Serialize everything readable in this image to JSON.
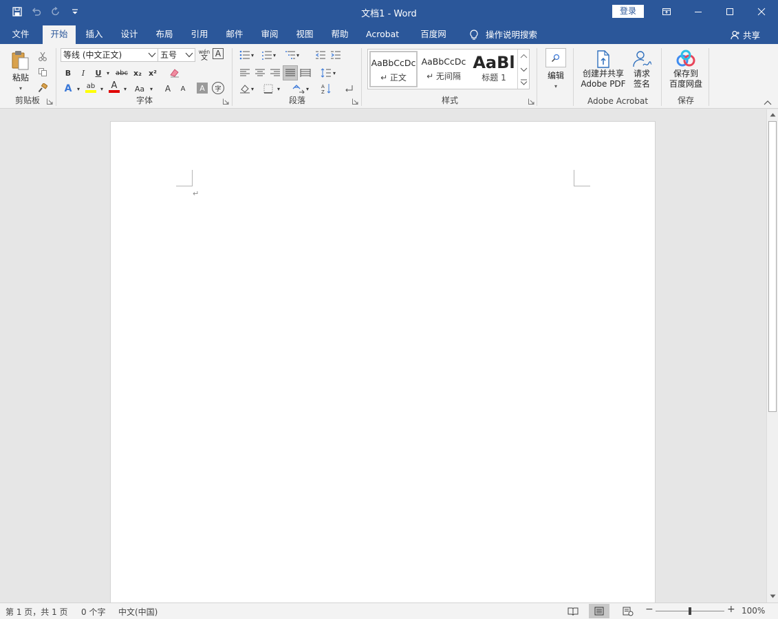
{
  "window": {
    "title": "文档1  -  Word",
    "login_label": "登录"
  },
  "tabs": [
    "文件",
    "开始",
    "插入",
    "设计",
    "布局",
    "引用",
    "邮件",
    "审阅",
    "视图",
    "帮助",
    "Acrobat",
    "百度网盘"
  ],
  "active_tab": "开始",
  "tell_me": "操作说明搜索",
  "share_label": "共享",
  "ribbon": {
    "clipboard": {
      "label": "剪贴板",
      "paste": "粘贴"
    },
    "font": {
      "label": "字体",
      "font_name": "等线 (中文正文)",
      "font_size": "五号",
      "phonetic_top": "wén",
      "phonetic_bottom": "文",
      "bold": "B",
      "italic": "I",
      "underline": "U",
      "strike": "abc",
      "subscript": "x₂",
      "superscript": "x²",
      "text_effects": "A",
      "highlight": "ab",
      "font_color": "A",
      "change_case": "Aa",
      "grow": "A",
      "shrink": "A",
      "char_shading": "A",
      "enclose": "字"
    },
    "paragraph": {
      "label": "段落"
    },
    "styles": {
      "label": "样式",
      "items": [
        {
          "sample": "AaBbCcDc",
          "name": "↵ 正文"
        },
        {
          "sample": "AaBbCcDc",
          "name": "↵ 无间隔"
        },
        {
          "sample": "AaBl",
          "name": "标题 1"
        }
      ]
    },
    "editing": {
      "label": "编辑"
    },
    "acrobat": {
      "label": "Adobe Acrobat",
      "create_line1": "创建并共享",
      "create_line2": "Adobe PDF",
      "sign_line1": "请求",
      "sign_line2": "签名"
    },
    "save": {
      "label": "保存",
      "save_line1": "保存到",
      "save_line2": "百度网盘"
    }
  },
  "document": {
    "paragraph_mark": "↵"
  },
  "status": {
    "page": "第 1 页，共 1 页",
    "words": "0 个字",
    "language": "中文(中国)",
    "zoom": "100%",
    "zoom_minus": "−",
    "zoom_plus": "+"
  },
  "colors": {
    "brand": "#2b579a",
    "highlight": "#ffff00",
    "font_color": "#e00000"
  }
}
